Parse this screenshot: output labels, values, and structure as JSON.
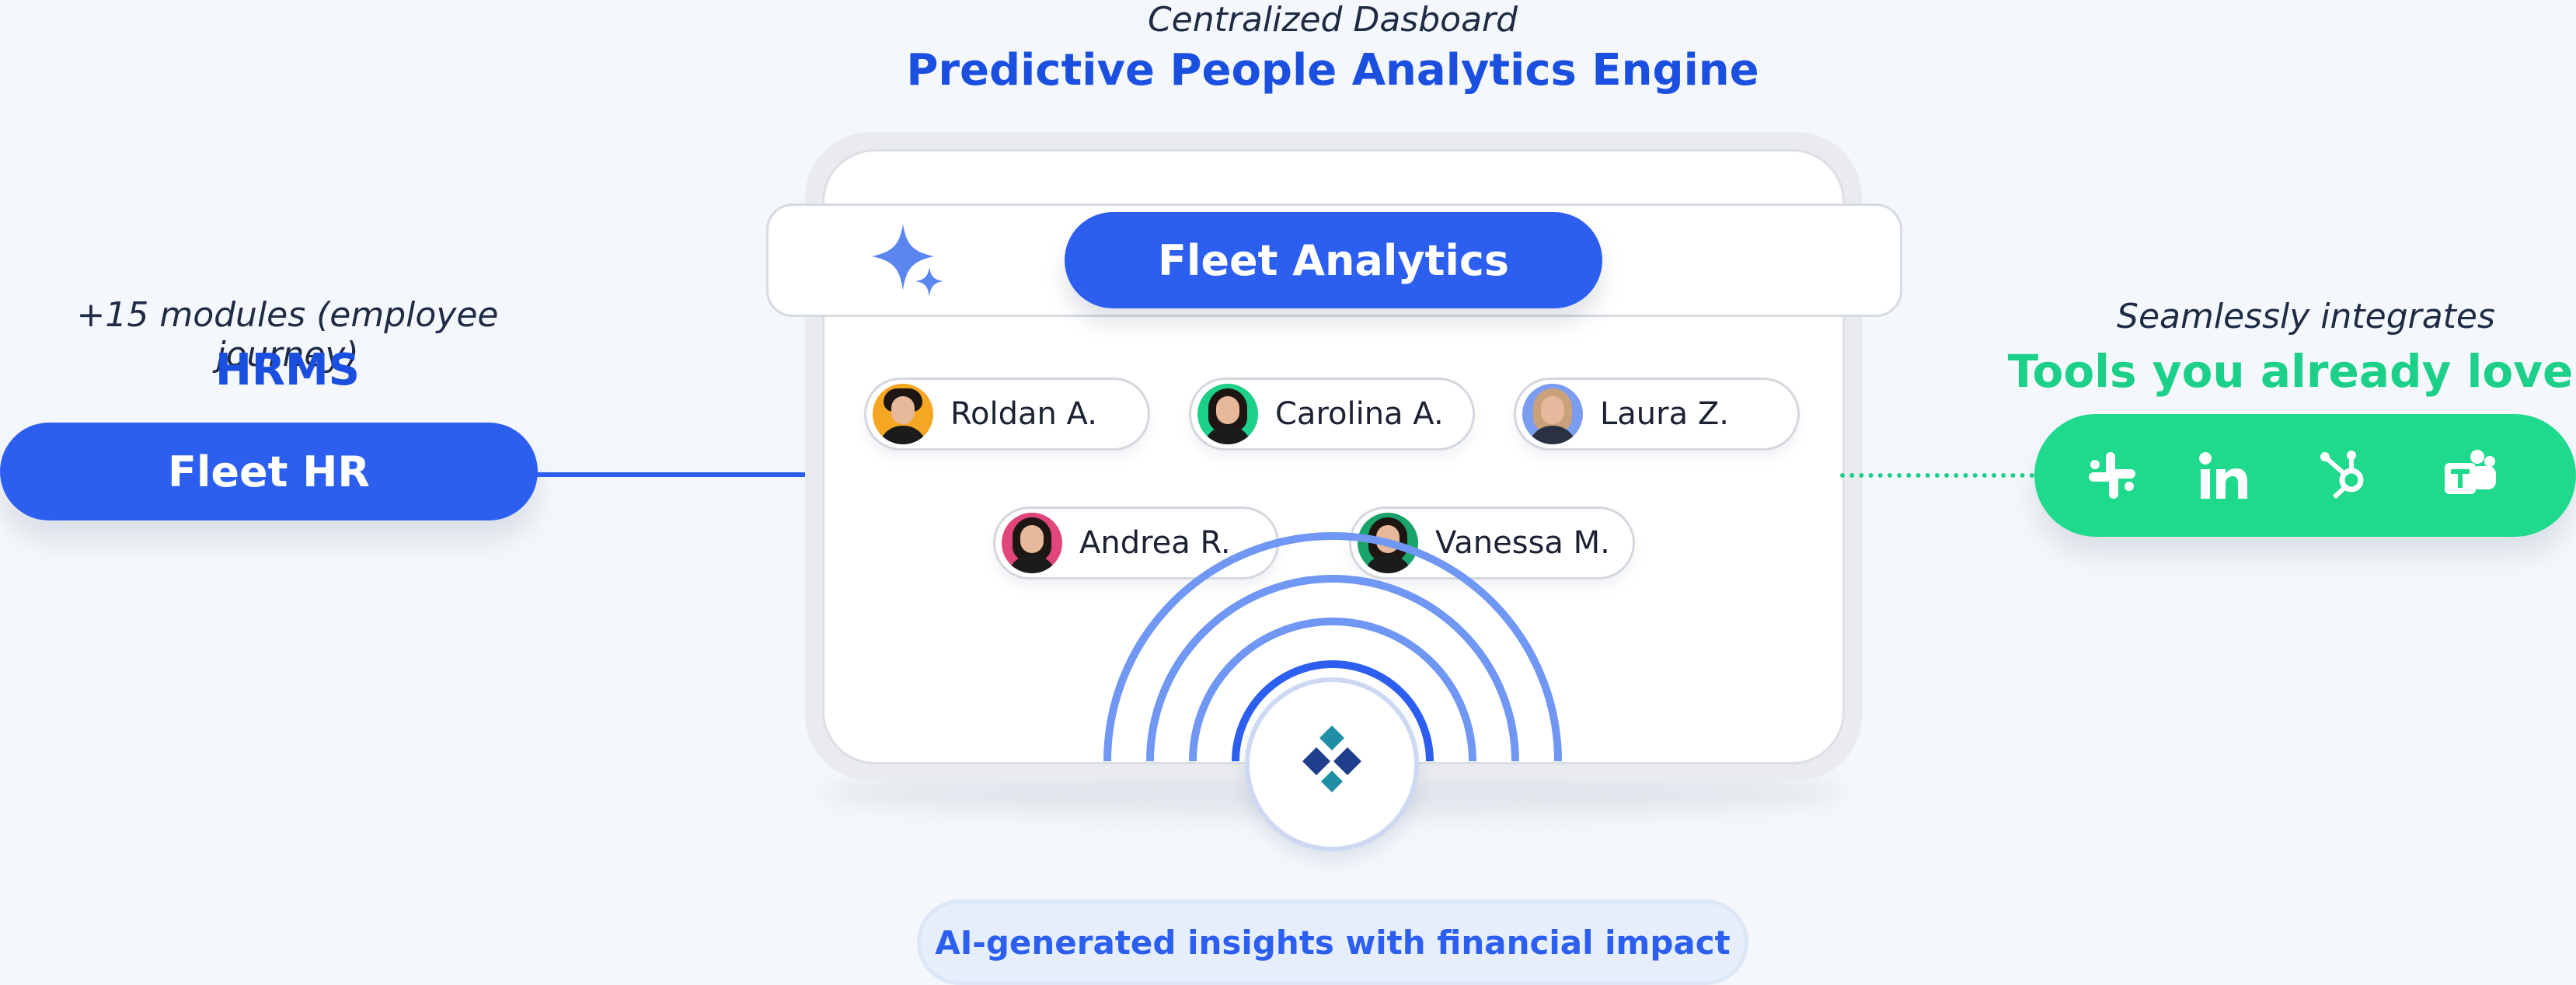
{
  "center": {
    "subtitle": "Centralized Dasboard",
    "title": "Predictive People Analytics Engine",
    "product": "Fleet Analytics"
  },
  "left": {
    "subtitle": "+15 modules (employee journey)",
    "title": "HRMS",
    "product": "Fleet HR"
  },
  "right": {
    "subtitle": "Seamlessly integrates",
    "title": "Tools you already love",
    "tools": [
      "slack-icon",
      "linkedin-icon",
      "hubspot-icon",
      "teams-icon"
    ]
  },
  "people": [
    {
      "name": "Roldan A.",
      "avatar_color": "#f5a623"
    },
    {
      "name": "Carolina A.",
      "avatar_color": "#1dd08a"
    },
    {
      "name": "Laura Z.",
      "avatar_color": "#7b9cf0"
    },
    {
      "name": "Andrea R.",
      "avatar_color": "#e0457b"
    },
    {
      "name": "Vanessa M.",
      "avatar_color": "#1aa36a"
    }
  ],
  "footer": {
    "insight": "AI-generated insights with financial impact"
  },
  "colors": {
    "primary_blue": "#2c5ff0",
    "title_blue": "#1a4fe0",
    "green": "#1dd08a",
    "background": "#f4f7fb"
  }
}
